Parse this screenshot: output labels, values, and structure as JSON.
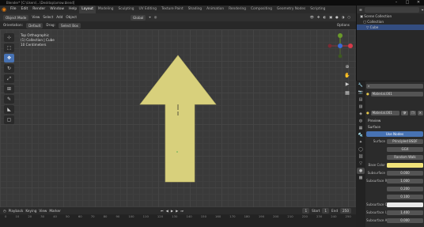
{
  "titlebar": {
    "text": "Blender* [C:\\Users\\...\\Desktop\\arrow.blend]"
  },
  "menu": {
    "items": [
      "File",
      "Edit",
      "Render",
      "Window",
      "Help"
    ],
    "workspaces": [
      "Layout",
      "Modeling",
      "Sculpting",
      "UV Editing",
      "Texture Paint",
      "Shading",
      "Animation",
      "Rendering",
      "Compositing",
      "Geometry Nodes",
      "Scripting"
    ],
    "scene_label": "Scene",
    "viewlayer_label": "ViewLayer"
  },
  "header2": {
    "mode": "Object Mode",
    "view": "View",
    "select": "Select",
    "add": "Add",
    "object": "Object",
    "orientation": "Global"
  },
  "header3": {
    "items": [
      "Orientation:",
      "Default",
      "Drag:",
      "Select Box"
    ],
    "options": "Options"
  },
  "viewport": {
    "info_line1": "Top Orthographic",
    "info_line2": "(1) Collection | Cube",
    "info_line3": "10 Centimeters",
    "arrow_color": "#d8d07c"
  },
  "toolbar": {
    "tools": [
      "cursor-icon",
      "select-icon",
      "move-icon",
      "rotate-icon",
      "scale-icon",
      "transform-icon",
      "annotate-icon",
      "measure-icon",
      "add-cube-icon"
    ]
  },
  "timeline": {
    "playback": "Playback",
    "keying": "Keying",
    "view": "View",
    "marker": "Marker",
    "start_label": "Start",
    "start": "1",
    "end_label": "End",
    "end": "250",
    "numbers": [
      "0",
      "10",
      "20",
      "30",
      "40",
      "50",
      "60",
      "70",
      "80",
      "90",
      "100",
      "110",
      "120",
      "130",
      "140",
      "150",
      "160",
      "170",
      "180",
      "190",
      "200",
      "210",
      "220",
      "230",
      "240",
      "250"
    ]
  },
  "outliner": {
    "title": "Scene Collection",
    "rows": [
      "Collection",
      "Cube"
    ]
  },
  "properties": {
    "search_placeholder": "",
    "object_name": "Material.001",
    "material_slot": "Material.001",
    "preview": "Preview",
    "surface": "Surface",
    "use_nodes": "Use Nodes",
    "surface_label": "Surface",
    "surface_value": "Principled BSDF",
    "gpu": "GGX",
    "random_walk": "Random Walk",
    "base_color": "Base Color",
    "subsurface": "Subsurface",
    "subsurface_value": "0.000",
    "subsurface_radius": "Subsurface Ra...",
    "radius_values": [
      "1.000",
      "0.200",
      "0.100"
    ],
    "subsurface_color": "Subsurface Col...",
    "subsurface_ior": "Subsurface I...",
    "subsurface_ior_value": "1.400",
    "subsurface_aniso": "Subsurface A...",
    "subsurface_aniso_value": "0.000",
    "metallic": "Metallic"
  }
}
